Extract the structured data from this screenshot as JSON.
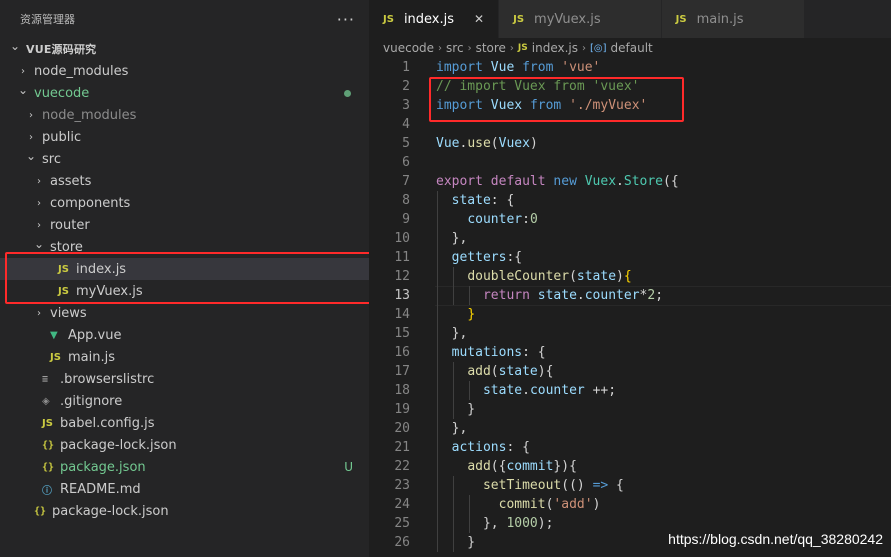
{
  "explorer": {
    "title": "资源管理器",
    "more": "···",
    "items": [
      {
        "label": "VUE源码研究",
        "indent": 0,
        "chev": "⌄",
        "icon": "",
        "cls": "root"
      },
      {
        "label": "node_modules",
        "indent": 1,
        "chev": "›",
        "icon": ""
      },
      {
        "label": "vuecode",
        "indent": 1,
        "chev": "⌄",
        "icon": "",
        "cls": "green",
        "dot": true
      },
      {
        "label": "node_modules",
        "indent": 2,
        "chev": "›",
        "icon": "",
        "cls": "muted"
      },
      {
        "label": "public",
        "indent": 2,
        "chev": "›",
        "icon": ""
      },
      {
        "label": "src",
        "indent": 2,
        "chev": "⌄",
        "icon": ""
      },
      {
        "label": "assets",
        "indent": 3,
        "chev": "›",
        "icon": ""
      },
      {
        "label": "components",
        "indent": 3,
        "chev": "›",
        "icon": ""
      },
      {
        "label": "router",
        "indent": 3,
        "chev": "›",
        "icon": ""
      },
      {
        "label": "store",
        "indent": 3,
        "chev": "⌄",
        "icon": ""
      },
      {
        "label": "index.js",
        "indent": 4,
        "chev": "",
        "icon": "JS",
        "iconCls": "js",
        "cls": "selected"
      },
      {
        "label": "myVuex.js",
        "indent": 4,
        "chev": "",
        "icon": "JS",
        "iconCls": "js"
      },
      {
        "label": "views",
        "indent": 3,
        "chev": "›",
        "icon": ""
      },
      {
        "label": "App.vue",
        "indent": 3,
        "chev": "",
        "icon": "▼",
        "iconCls": "vue"
      },
      {
        "label": "main.js",
        "indent": 3,
        "chev": "",
        "icon": "JS",
        "iconCls": "js"
      },
      {
        "label": ".browserslistrc",
        "indent": 2,
        "chev": "",
        "icon": "≡",
        "iconCls": "lines"
      },
      {
        "label": ".gitignore",
        "indent": 2,
        "chev": "",
        "icon": "◈",
        "iconCls": "diamond"
      },
      {
        "label": "babel.config.js",
        "indent": 2,
        "chev": "",
        "icon": "JS",
        "iconCls": "js"
      },
      {
        "label": "package-lock.json",
        "indent": 2,
        "chev": "",
        "icon": "{}",
        "iconCls": "json"
      },
      {
        "label": "package.json",
        "indent": 2,
        "chev": "",
        "icon": "{}",
        "iconCls": "json",
        "cls": "green",
        "badge": "U"
      },
      {
        "label": "README.md",
        "indent": 2,
        "chev": "",
        "icon": "ⓘ",
        "iconCls": "info"
      },
      {
        "label": "package-lock.json",
        "indent": 1,
        "chev": "",
        "icon": "{}",
        "iconCls": "json"
      }
    ]
  },
  "tabs": [
    {
      "label": "index.js",
      "active": true,
      "close": "✕"
    },
    {
      "label": "myVuex.js",
      "active": false
    },
    {
      "label": "main.js",
      "active": false
    }
  ],
  "breadcrumb": {
    "parts": [
      "vuecode",
      "src",
      "store"
    ],
    "file": "index.js",
    "symbol": "default"
  },
  "code": {
    "current_line": 13,
    "lines": [
      [
        [
          "k",
          "import "
        ],
        [
          "v",
          "Vue "
        ],
        [
          "k",
          "from "
        ],
        [
          "s",
          "'vue'"
        ]
      ],
      [
        [
          "c",
          "// import Vuex from 'vuex'"
        ]
      ],
      [
        [
          "k",
          "import "
        ],
        [
          "v",
          "Vuex "
        ],
        [
          "k",
          "from "
        ],
        [
          "s",
          "'./myVuex'"
        ]
      ],
      [],
      [
        [
          "v",
          "Vue"
        ],
        [
          "p",
          "."
        ],
        [
          "f",
          "use"
        ],
        [
          "p",
          "("
        ],
        [
          "v",
          "Vuex"
        ],
        [
          "p",
          ")"
        ]
      ],
      [],
      [
        [
          "kw",
          "export "
        ],
        [
          "kw",
          "default "
        ],
        [
          "k",
          "new "
        ],
        [
          "t",
          "Vuex"
        ],
        [
          "p",
          "."
        ],
        [
          "t",
          "Store"
        ],
        [
          "p",
          "({"
        ]
      ],
      [
        [
          "p",
          "  "
        ],
        [
          "v",
          "state"
        ],
        [
          "p",
          ": {"
        ]
      ],
      [
        [
          "p",
          "    "
        ],
        [
          "v",
          "counter"
        ],
        [
          "p",
          ":"
        ],
        [
          "n",
          "0"
        ]
      ],
      [
        [
          "p",
          "  },"
        ]
      ],
      [
        [
          "p",
          "  "
        ],
        [
          "v",
          "getters"
        ],
        [
          "p",
          ":{"
        ]
      ],
      [
        [
          "p",
          "    "
        ],
        [
          "f",
          "doubleCounter"
        ],
        [
          "p",
          "("
        ],
        [
          "v",
          "state"
        ],
        [
          "p",
          ")"
        ],
        [
          "y",
          "{"
        ]
      ],
      [
        [
          "p",
          "      "
        ],
        [
          "kw",
          "return "
        ],
        [
          "v",
          "state"
        ],
        [
          "p",
          "."
        ],
        [
          "v",
          "counter"
        ],
        [
          "p",
          "*"
        ],
        [
          "n",
          "2"
        ],
        [
          "p",
          ";"
        ]
      ],
      [
        [
          "p",
          "    "
        ],
        [
          "y",
          "}"
        ]
      ],
      [
        [
          "p",
          "  },"
        ]
      ],
      [
        [
          "p",
          "  "
        ],
        [
          "v",
          "mutations"
        ],
        [
          "p",
          ": {"
        ]
      ],
      [
        [
          "p",
          "    "
        ],
        [
          "f",
          "add"
        ],
        [
          "p",
          "("
        ],
        [
          "v",
          "state"
        ],
        [
          "p",
          "){"
        ]
      ],
      [
        [
          "p",
          "      "
        ],
        [
          "v",
          "state"
        ],
        [
          "p",
          "."
        ],
        [
          "v",
          "counter "
        ],
        [
          "p",
          "++;"
        ]
      ],
      [
        [
          "p",
          "    }"
        ]
      ],
      [
        [
          "p",
          "  },"
        ]
      ],
      [
        [
          "p",
          "  "
        ],
        [
          "v",
          "actions"
        ],
        [
          "p",
          ": {"
        ]
      ],
      [
        [
          "p",
          "    "
        ],
        [
          "f",
          "add"
        ],
        [
          "p",
          "({"
        ],
        [
          "v",
          "commit"
        ],
        [
          "p",
          "}){"
        ]
      ],
      [
        [
          "p",
          "      "
        ],
        [
          "f",
          "setTimeout"
        ],
        [
          "p",
          "(() "
        ],
        [
          "k",
          "=> "
        ],
        [
          "p",
          "{"
        ]
      ],
      [
        [
          "p",
          "        "
        ],
        [
          "f",
          "commit"
        ],
        [
          "p",
          "("
        ],
        [
          "s",
          "'add'"
        ],
        [
          "p",
          ")"
        ]
      ],
      [
        [
          "p",
          "      }, "
        ],
        [
          "n",
          "1000"
        ],
        [
          "p",
          ");"
        ]
      ],
      [
        [
          "p",
          "    }"
        ]
      ]
    ]
  },
  "watermark": "https://blog.csdn.net/qq_38280242"
}
